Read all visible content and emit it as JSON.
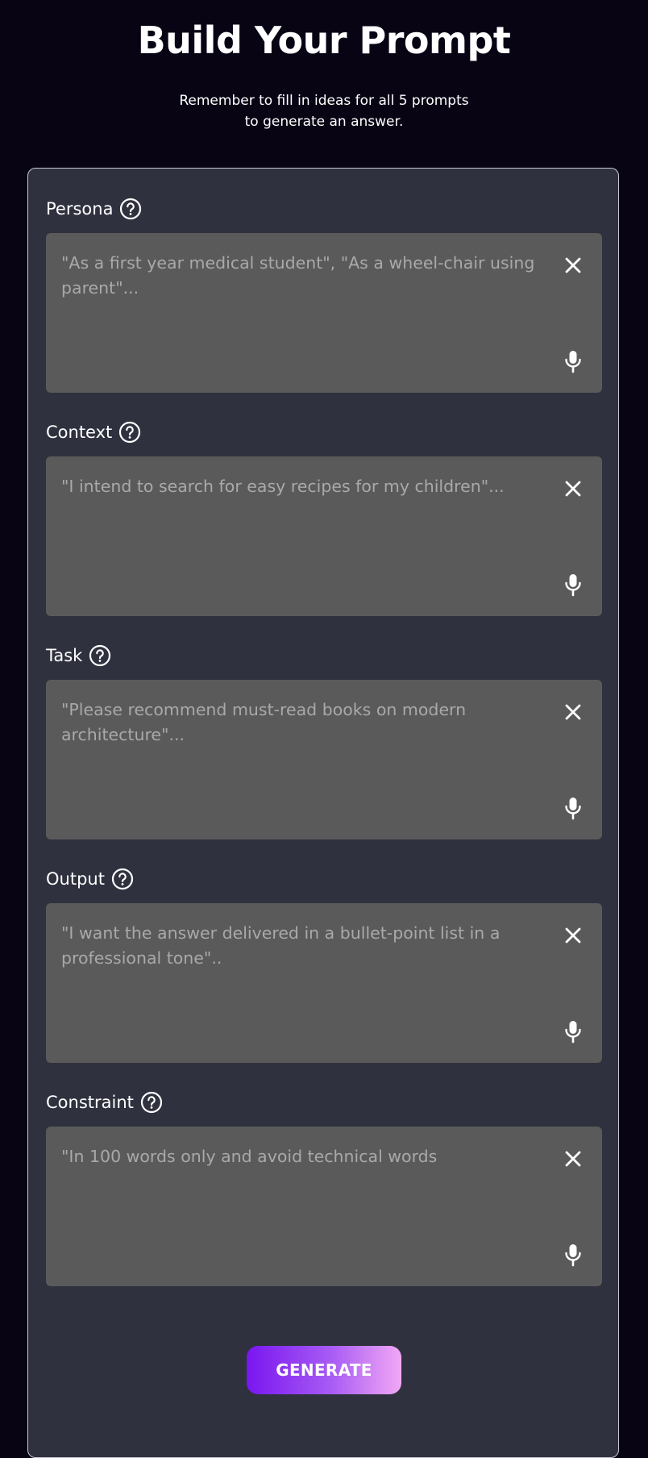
{
  "header": {
    "title": "Build Your Prompt",
    "subtitle_line1": "Remember to fill in ideas for all 5 prompts",
    "subtitle_line2": "to generate an answer."
  },
  "fields": [
    {
      "label": "Persona",
      "value": "",
      "placeholder": "\"As a first year medical student\", \"As a wheel-chair using parent\"..."
    },
    {
      "label": "Context",
      "value": "",
      "placeholder": "\"I intend to search for easy recipes for my children\"..."
    },
    {
      "label": "Task",
      "value": "",
      "placeholder": "\"Please recommend must-read books on modern architecture\"..."
    },
    {
      "label": "Output",
      "value": "",
      "placeholder": "\"I want the answer delivered in a bullet-point list in a professional tone\".."
    },
    {
      "label": "Constraint",
      "value": "",
      "placeholder": "\"In 100 words only and avoid technical words"
    }
  ],
  "icons": {
    "help": "question-circle-icon",
    "clear": "close-icon",
    "voice": "microphone-icon"
  },
  "actions": {
    "generate_label": "GENERATE"
  },
  "colors": {
    "background": "#080414",
    "card": "#2f313f",
    "input": "#5a5a5a",
    "placeholder": "#a9a9a9",
    "button_gradient_start": "#7a16f0",
    "button_gradient_end": "#f2a8f5"
  }
}
